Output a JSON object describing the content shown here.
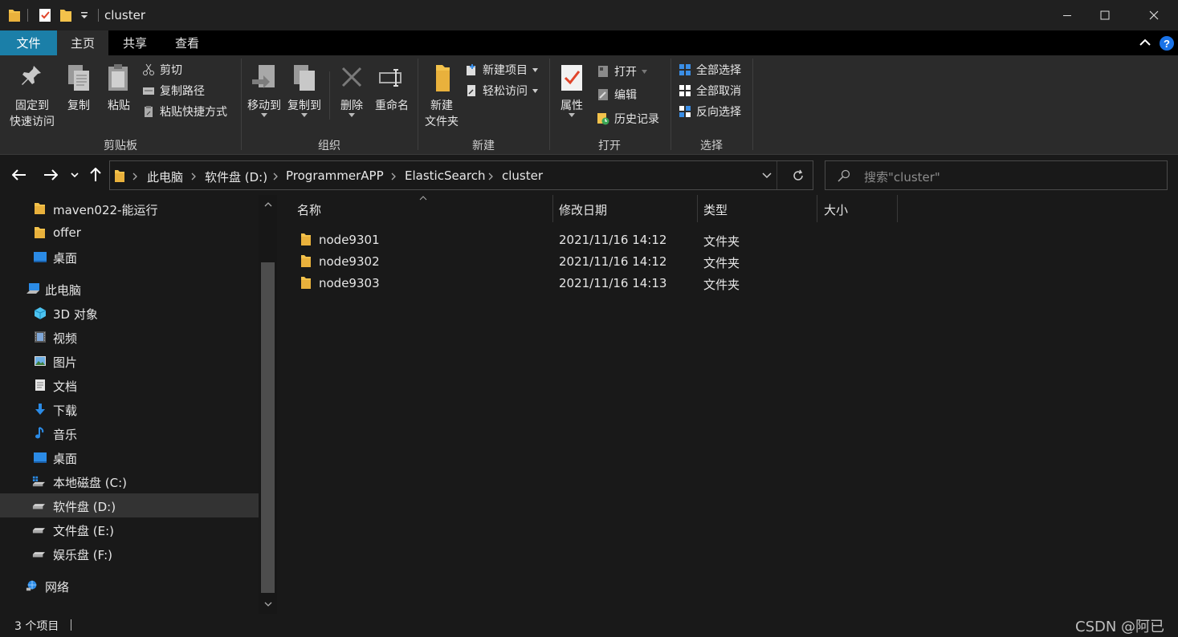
{
  "window": {
    "title": "cluster",
    "minimize_glyph": "—",
    "maximize_glyph": "☐",
    "close_glyph": "✕"
  },
  "ribbon_tabs": [
    "文件",
    "主页",
    "共享",
    "查看"
  ],
  "ribbon": {
    "clipboard": {
      "pin_line1": "固定到",
      "pin_line2": "快速访问",
      "copy": "复制",
      "paste": "粘贴",
      "cut": "剪切",
      "copy_path": "复制路径",
      "paste_shortcut": "粘贴快捷方式",
      "group": "剪贴板"
    },
    "organize": {
      "move_to": "移动到",
      "copy_to": "复制到",
      "delete": "删除",
      "rename": "重命名",
      "group": "组织"
    },
    "new": {
      "new_folder_line1": "新建",
      "new_folder_line2": "文件夹",
      "new_item": "新建项目",
      "easy_access": "轻松访问",
      "group": "新建"
    },
    "open": {
      "properties": "属性",
      "open": "打开",
      "edit": "编辑",
      "history": "历史记录",
      "group": "打开"
    },
    "select": {
      "select_all": "全部选择",
      "select_none": "全部取消",
      "invert": "反向选择",
      "group": "选择"
    }
  },
  "address": {
    "crumbs": [
      "此电脑",
      "软件盘 (D:)",
      "ProgrammerAPP",
      "ElasticSearch",
      "cluster"
    ],
    "search_placeholder": "搜索\"cluster\""
  },
  "nav": {
    "items": [
      {
        "label": "maven022-能运行",
        "icon": "folder-icon"
      },
      {
        "label": "offer",
        "icon": "folder-icon"
      },
      {
        "label": "桌面",
        "icon": "desktop-icon"
      },
      {
        "label": "此电脑",
        "icon": "computer-icon"
      },
      {
        "label": "3D 对象",
        "icon": "3d-objects-icon"
      },
      {
        "label": "视频",
        "icon": "video-icon"
      },
      {
        "label": "图片",
        "icon": "pictures-icon"
      },
      {
        "label": "文档",
        "icon": "documents-icon"
      },
      {
        "label": "下载",
        "icon": "download-icon"
      },
      {
        "label": "音乐",
        "icon": "music-icon"
      },
      {
        "label": "桌面",
        "icon": "desktop-icon"
      },
      {
        "label": "本地磁盘 (C:)",
        "icon": "system-drive-icon"
      },
      {
        "label": "软件盘 (D:)",
        "icon": "drive-icon",
        "selected": true
      },
      {
        "label": "文件盘 (E:)",
        "icon": "drive-icon"
      },
      {
        "label": "娱乐盘 (F:)",
        "icon": "drive-icon"
      },
      {
        "label": "网络",
        "icon": "network-icon"
      }
    ]
  },
  "list": {
    "columns": [
      "名称",
      "修改日期",
      "类型",
      "大小"
    ],
    "rows": [
      {
        "name": "node9301",
        "date": "2021/11/16 14:12",
        "type": "文件夹",
        "size": ""
      },
      {
        "name": "node9302",
        "date": "2021/11/16 14:12",
        "type": "文件夹",
        "size": ""
      },
      {
        "name": "node9303",
        "date": "2021/11/16 14:13",
        "type": "文件夹",
        "size": ""
      }
    ]
  },
  "status": {
    "item_count": "3 个项目",
    "watermark": "CSDN @阿已"
  },
  "colors": {
    "file_tab": "#1b7fa8",
    "folder": "#f3c24b",
    "accent_blue": "#3a8ee6",
    "help": "#1a73e8"
  }
}
